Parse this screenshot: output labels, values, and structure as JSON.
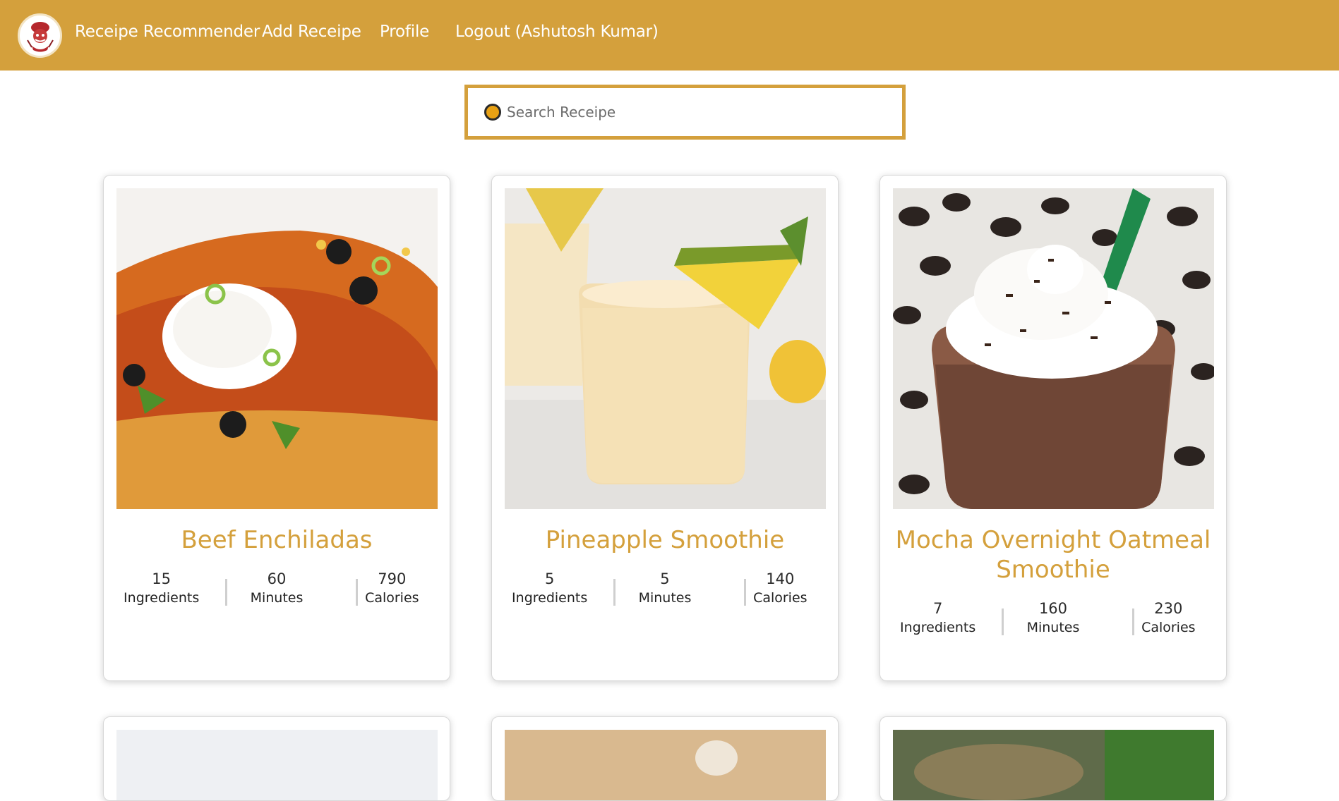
{
  "nav": {
    "brand": "Receipe Recommender",
    "add": "Add Receipe",
    "profile": "Profile",
    "logout": "Logout (Ashutosh Kumar)"
  },
  "search": {
    "placeholder": "Search Receipe"
  },
  "recipes": [
    {
      "title": "Beef Enchiladas",
      "ingredients": "15",
      "minutes": "60",
      "calories": "790"
    },
    {
      "title": "Pineapple Smoothie",
      "ingredients": "5",
      "minutes": "5",
      "calories": "140"
    },
    {
      "title": "Mocha Overnight Oatmeal Smoothie",
      "ingredients": "7",
      "minutes": "160",
      "calories": "230"
    }
  ],
  "labels": {
    "ingredients": "Ingredients",
    "minutes": "Minutes",
    "calories": "Calories"
  },
  "colors": {
    "accent": "#d4a03c",
    "text": "#222222"
  }
}
